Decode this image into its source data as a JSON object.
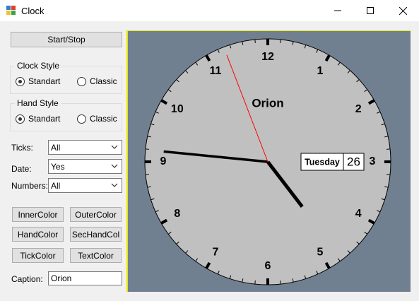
{
  "window": {
    "title": "Clock"
  },
  "controls": {
    "start_stop_label": "Start/Stop",
    "clock_style": {
      "legend": "Clock Style",
      "option1": "Standart",
      "option2": "Classic"
    },
    "hand_style": {
      "legend": "Hand Style",
      "option1": "Standart",
      "option2": "Classic"
    },
    "ticks": {
      "label": "Ticks:",
      "value": "All"
    },
    "date": {
      "label": "Date:",
      "value": "Yes"
    },
    "numbers": {
      "label": "Numbers:",
      "value": "All"
    },
    "color_buttons": [
      "InnerColor",
      "OuterColor",
      "HandColor",
      "SecHandCol",
      "TickColor",
      "TextColor"
    ],
    "caption": {
      "label": "Caption:",
      "value": "Orion"
    }
  },
  "clock": {
    "caption": "Orion",
    "numerals": [
      "12",
      "1",
      "2",
      "3",
      "4",
      "5",
      "6",
      "7",
      "8",
      "9",
      "10",
      "11"
    ],
    "day": "Tuesday",
    "date": "26",
    "time": {
      "hour": 4,
      "minute": 45,
      "second": 56.5
    }
  },
  "colors": {
    "panel_bg": "#708090",
    "face": "#c0c0c0",
    "second_hand": "#ff0000",
    "hands": "#000000",
    "panel_border": "#e6e600"
  },
  "icons": {
    "app": "clock-app-icon",
    "minimize": "minimize-icon",
    "maximize": "maximize-icon",
    "close": "close-icon"
  }
}
